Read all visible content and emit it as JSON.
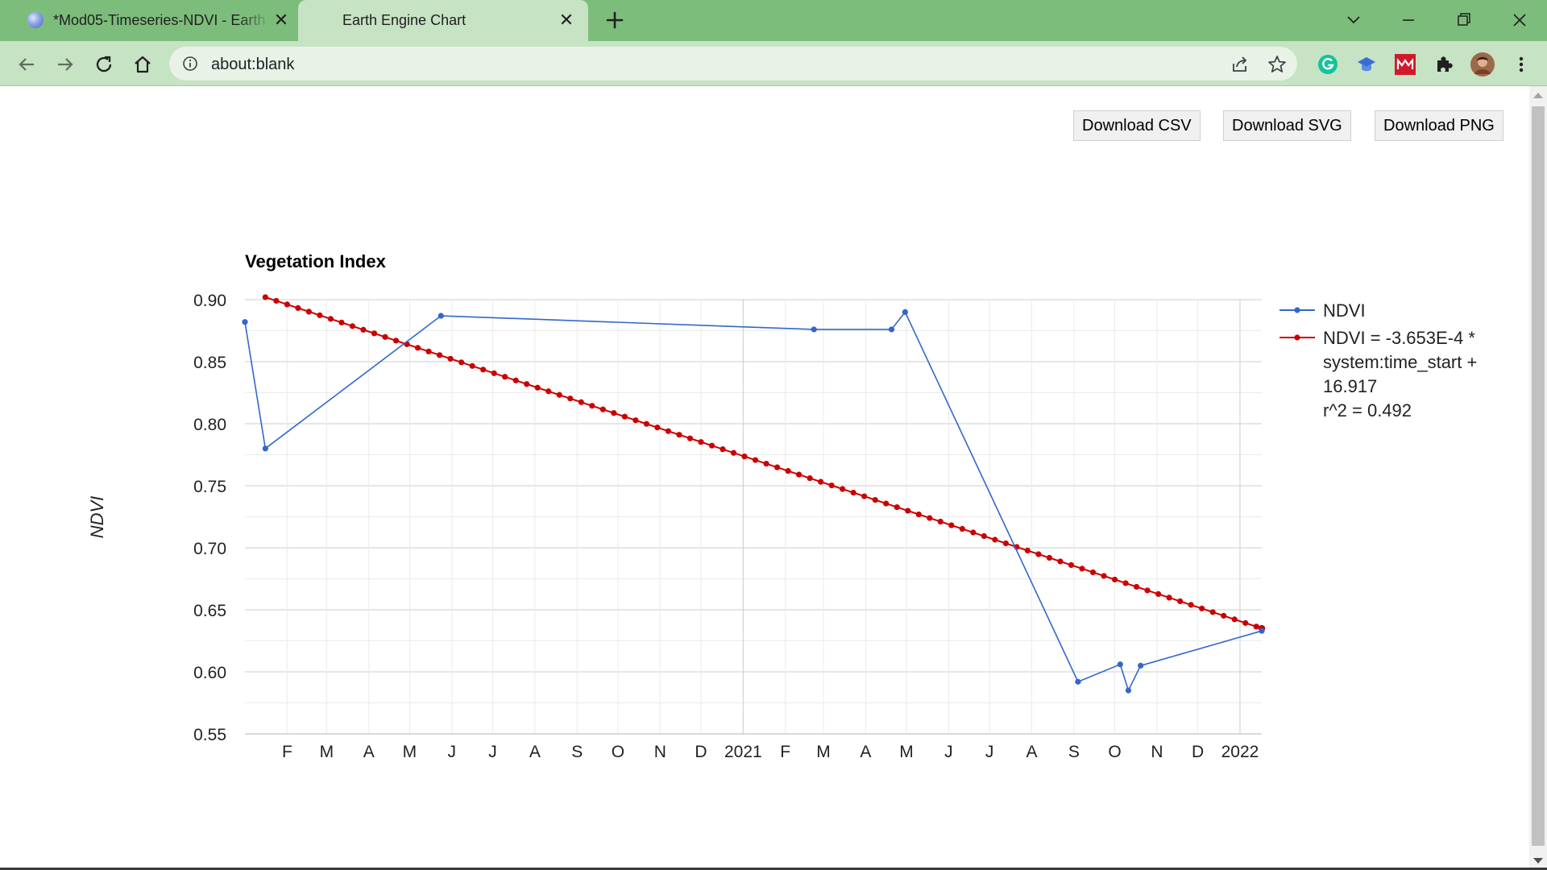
{
  "browser": {
    "tabs": [
      {
        "title": "*Mod05-Timeseries-NDVI - Earth Engine Code Editor",
        "active": false,
        "close": "✕"
      },
      {
        "title": "Earth Engine Chart",
        "active": true,
        "close": "✕"
      }
    ],
    "address": "about:blank",
    "icons": {
      "back": "arrow-left-icon",
      "forward": "arrow-right-icon",
      "reload": "reload-icon",
      "home": "home-icon",
      "share": "share-icon",
      "bookmark": "star-icon",
      "grammarly": "grammarly-icon",
      "ext_cap": "graduation-cap-icon",
      "ext_red": "mendeley-icon",
      "extensions": "puzzle-icon",
      "profile": "avatar",
      "menu": "kebab-menu-icon"
    },
    "colors": {
      "frame": "#7dbd7b",
      "toolbar": "#c6e3c3",
      "omnibox": "#e8f2e7"
    }
  },
  "page": {
    "buttons": {
      "csv": "Download CSV",
      "svg": "Download SVG",
      "png": "Download PNG"
    }
  },
  "chart_data": {
    "type": "line",
    "title": "Vegetation Index",
    "ylabel": "NDVI",
    "xlabel": "",
    "ylim": [
      0.55,
      0.9
    ],
    "yticks": [
      "0.90",
      "0.85",
      "0.80",
      "0.75",
      "0.70",
      "0.65",
      "0.60",
      "0.55"
    ],
    "xlim": [
      "2020-01-01",
      "2022-01-17"
    ],
    "xticks": [
      {
        "date": "2020-02-01",
        "label": "F"
      },
      {
        "date": "2020-03-01",
        "label": "M"
      },
      {
        "date": "2020-04-01",
        "label": "A"
      },
      {
        "date": "2020-05-01",
        "label": "M"
      },
      {
        "date": "2020-06-01",
        "label": "J"
      },
      {
        "date": "2020-07-01",
        "label": "J"
      },
      {
        "date": "2020-08-01",
        "label": "A"
      },
      {
        "date": "2020-09-01",
        "label": "S"
      },
      {
        "date": "2020-10-01",
        "label": "O"
      },
      {
        "date": "2020-11-01",
        "label": "N"
      },
      {
        "date": "2020-12-01",
        "label": "D"
      },
      {
        "date": "2021-01-01",
        "label": "2021"
      },
      {
        "date": "2021-02-01",
        "label": "F"
      },
      {
        "date": "2021-03-01",
        "label": "M"
      },
      {
        "date": "2021-04-01",
        "label": "A"
      },
      {
        "date": "2021-05-01",
        "label": "M"
      },
      {
        "date": "2021-06-01",
        "label": "J"
      },
      {
        "date": "2021-07-01",
        "label": "J"
      },
      {
        "date": "2021-08-01",
        "label": "A"
      },
      {
        "date": "2021-09-01",
        "label": "S"
      },
      {
        "date": "2021-10-01",
        "label": "O"
      },
      {
        "date": "2021-11-01",
        "label": "N"
      },
      {
        "date": "2021-12-01",
        "label": "D"
      },
      {
        "date": "2022-01-01",
        "label": "2022"
      }
    ],
    "grid": true,
    "legend": "right",
    "series": [
      {
        "name": "NDVI",
        "color": "#3366cc",
        "points": [
          {
            "x": "2020-01-01",
            "y": 0.882
          },
          {
            "x": "2020-01-16",
            "y": 0.78
          },
          {
            "x": "2020-05-24",
            "y": 0.887
          },
          {
            "x": "2021-02-22",
            "y": 0.876
          },
          {
            "x": "2021-04-20",
            "y": 0.876
          },
          {
            "x": "2021-04-30",
            "y": 0.89
          },
          {
            "x": "2021-09-04",
            "y": 0.592
          },
          {
            "x": "2021-10-05",
            "y": 0.606
          },
          {
            "x": "2021-10-11",
            "y": 0.585
          },
          {
            "x": "2021-10-20",
            "y": 0.605
          },
          {
            "x": "2022-01-17",
            "y": 0.633
          }
        ]
      },
      {
        "name": "NDVI = -3.653E-4 * system:time_start + 16.917 r^2 = 0.492",
        "legend_lines": [
          "NDVI = -3.653E-4 *",
          "system:time_start +",
          "16.917",
          "r^2 = 0.492"
        ],
        "color": "#cc0000",
        "line": {
          "start": {
            "x": "2020-01-16",
            "y": 0.902
          },
          "end": {
            "x": "2022-01-17",
            "y": 0.635
          }
        },
        "point_interval_days": 8
      }
    ]
  }
}
